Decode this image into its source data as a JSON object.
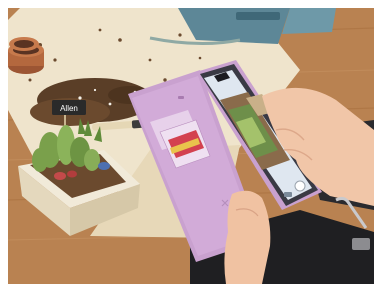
{
  "photo": {
    "sign_text": "Allen"
  },
  "colors": {
    "background": "#ffffff",
    "table": "#b98251",
    "paper": "#efe4cc",
    "soil": "#5a3e27",
    "planter": "#f1ead9",
    "cactus": "#7aa04b",
    "wallet_case": "#c9a1cf",
    "phone_frame": "#3a3a44",
    "screen": "#dfe7f0",
    "skin": "#f1c6a8",
    "sleeve": "#1f1f22",
    "pots": "#b4683e",
    "trays": "#5d8797"
  }
}
